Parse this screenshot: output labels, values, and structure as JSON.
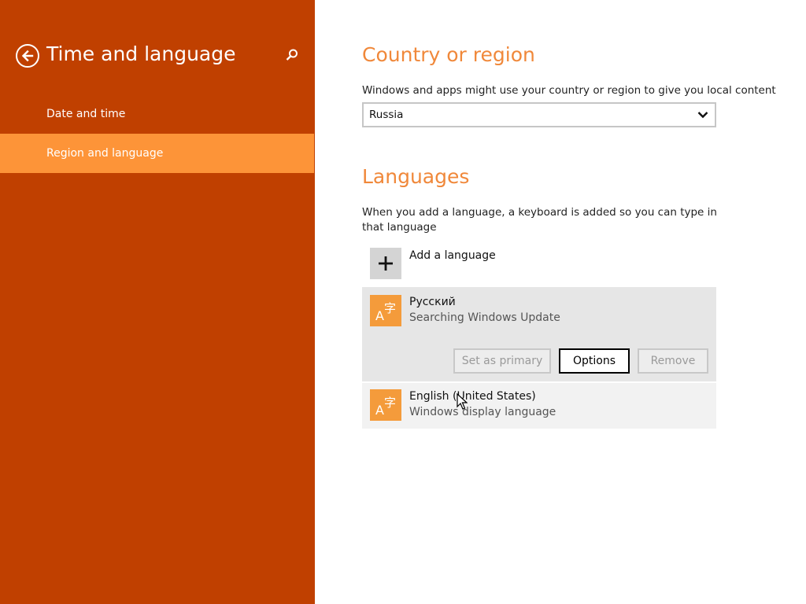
{
  "sidebar": {
    "title": "Time and language",
    "items": [
      {
        "label": "Date and time",
        "selected": false
      },
      {
        "label": "Region and language",
        "selected": true
      }
    ],
    "back_icon": "back-arrow-icon",
    "search_icon": "search-icon"
  },
  "country": {
    "title": "Country or region",
    "description": "Windows and apps might use your country or region to give you local content",
    "selected": "Russia"
  },
  "languages": {
    "title": "Languages",
    "description": "When you add a language, a keyboard is added so you can type in that language",
    "add_label": "Add a language",
    "items": [
      {
        "name": "Русский",
        "status": "Searching Windows Update",
        "buttons": {
          "set_primary": "Set as primary",
          "options": "Options",
          "remove": "Remove"
        }
      },
      {
        "name": "English (United States)",
        "status": "Windows display language"
      }
    ]
  },
  "colors": {
    "sidebar_bg": "#c04000",
    "selected_nav": "#fd9438",
    "accent": "#f0883a",
    "lang_icon_bg": "#f49b3b"
  }
}
